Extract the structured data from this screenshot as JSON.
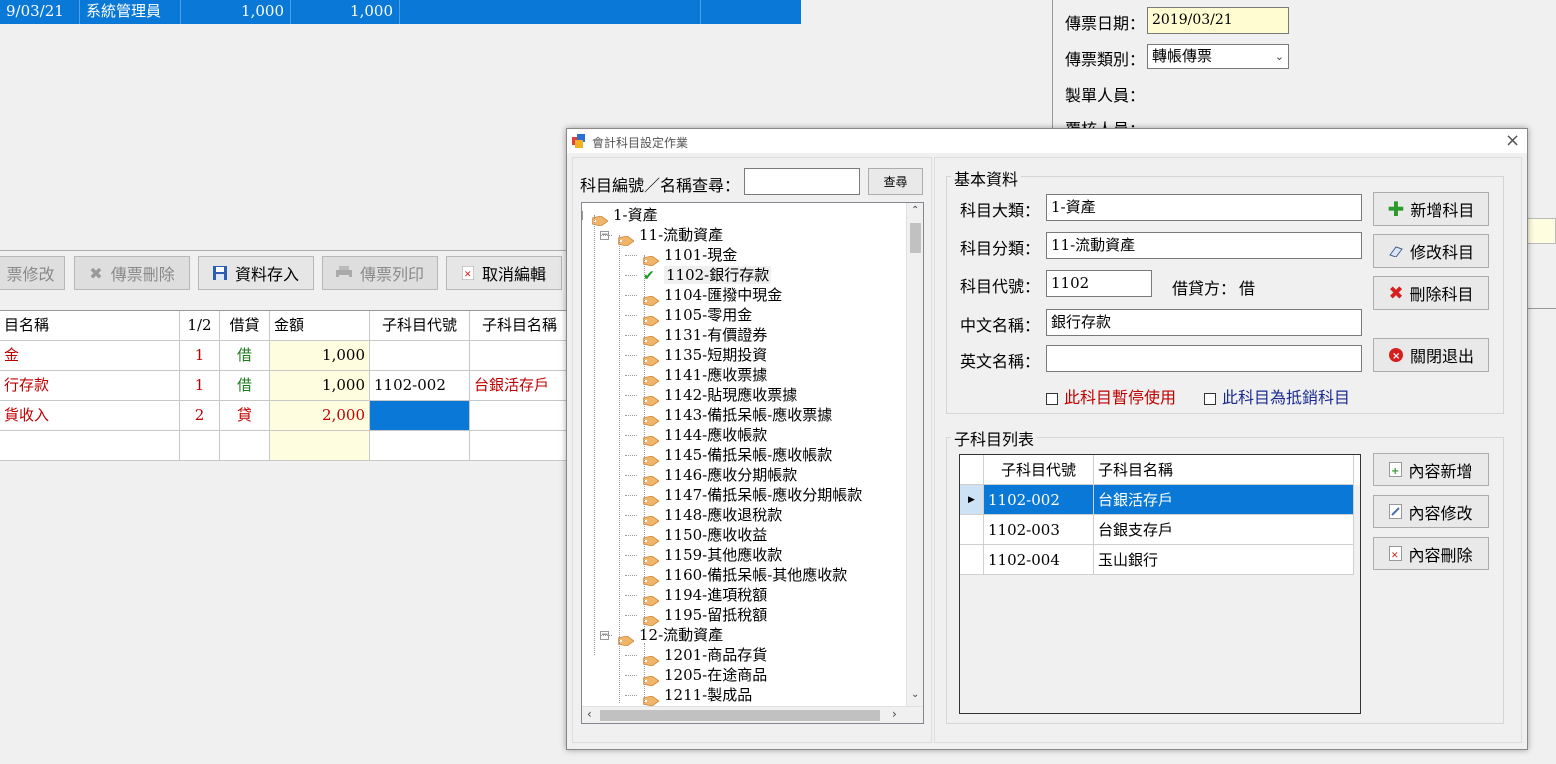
{
  "top_row": {
    "date": "9/03/21",
    "user": "系統管理員",
    "debit": "1,000",
    "credit": "1,000"
  },
  "right_panel": {
    "date_label": "傳票日期：",
    "date_value": "2019/03/21",
    "type_label": "傳票類別：",
    "type_value": "轉帳傳票",
    "maker_label": "製單人員：",
    "reviewer_label": "覆核人員："
  },
  "toolbar": {
    "edit": "票修改",
    "delete": "傳票刪除",
    "save": "資料存入",
    "print": "傳票列印",
    "cancel": "取消編輯"
  },
  "voucher_grid": {
    "headers": [
      "目名稱",
      "1/2",
      "借貸",
      "金額",
      "子科目代號",
      "子科目名稱"
    ],
    "rows": [
      {
        "name": "金",
        "seq": "1",
        "dc": "借",
        "amount": "1,000",
        "sub_code": "",
        "sub_name": ""
      },
      {
        "name": "行存款",
        "seq": "1",
        "dc": "借",
        "amount": "1,000",
        "sub_code": "1102-002",
        "sub_name": "台銀活存戶"
      },
      {
        "name": "貨收入",
        "seq": "2",
        "dc": "貸",
        "amount": "2,000",
        "sub_code": "",
        "sub_name": ""
      }
    ]
  },
  "dialog": {
    "title": "會計科目設定作業",
    "search_label": "科目編號／名稱查尋：",
    "search_value": "",
    "search_button": "查尋",
    "tree": [
      {
        "label": "1-資產",
        "level": 0,
        "expander": "⊟"
      },
      {
        "label": "11-流動資產",
        "level": 1,
        "expander": "⊟"
      },
      {
        "label": "1101-現金",
        "level": 2
      },
      {
        "label": "1102-銀行存款",
        "level": 2,
        "selected": true
      },
      {
        "label": "1104-匯撥中現金",
        "level": 2
      },
      {
        "label": "1105-零用金",
        "level": 2
      },
      {
        "label": "1131-有價證券",
        "level": 2
      },
      {
        "label": "1135-短期投資",
        "level": 2
      },
      {
        "label": "1141-應收票據",
        "level": 2
      },
      {
        "label": "1142-貼現應收票據",
        "level": 2
      },
      {
        "label": "1143-備抵呆帳-應收票據",
        "level": 2
      },
      {
        "label": "1144-應收帳款",
        "level": 2
      },
      {
        "label": "1145-備抵呆帳-應收帳款",
        "level": 2
      },
      {
        "label": "1146-應收分期帳款",
        "level": 2
      },
      {
        "label": "1147-備抵呆帳-應收分期帳款",
        "level": 2
      },
      {
        "label": "1148-應收退稅款",
        "level": 2
      },
      {
        "label": "1150-應收收益",
        "level": 2
      },
      {
        "label": "1159-其他應收款",
        "level": 2
      },
      {
        "label": "1160-備抵呆帳-其他應收款",
        "level": 2
      },
      {
        "label": "1194-進項稅額",
        "level": 2
      },
      {
        "label": "1195-留抵稅額",
        "level": 2
      },
      {
        "label": "12-流動資產",
        "level": 1,
        "expander": "⊟"
      },
      {
        "label": "1201-商品存貨",
        "level": 2
      },
      {
        "label": "1205-在途商品",
        "level": 2
      },
      {
        "label": "1211-製成品",
        "level": 2
      }
    ],
    "basic": {
      "group_title": "基本資料",
      "major_label": "科目大類：",
      "major_value": "1-資產",
      "minor_label": "科目分類：",
      "minor_value": "11-流動資產",
      "code_label": "科目代號：",
      "code_value": "1102",
      "dc_label": "借貸方：",
      "dc_value": "借",
      "cname_label": "中文名稱：",
      "cname_value": "銀行存款",
      "ename_label": "英文名稱：",
      "ename_value": "",
      "suspend_label": "此科目暫停使用",
      "offset_label": "此科目為抵銷科目"
    },
    "buttons": {
      "add": "新增科目",
      "modify": "修改科目",
      "delete": "刪除科目",
      "close": "關閉退出"
    },
    "sub": {
      "group_title": "子科目列表",
      "headers": [
        "子科目代號",
        "子科目名稱"
      ],
      "rows": [
        {
          "code": "1102-002",
          "name": "台銀活存戶"
        },
        {
          "code": "1102-003",
          "name": "台銀支存戶"
        },
        {
          "code": "1102-004",
          "name": "玉山銀行"
        }
      ],
      "add": "內容新增",
      "modify": "內容修改",
      "delete": "內容刪除"
    }
  },
  "colors": {
    "selection": "#0a78d7",
    "amount_bg": "#fffde0",
    "red_text": "#c00000",
    "green_text": "#1e7a1e"
  }
}
